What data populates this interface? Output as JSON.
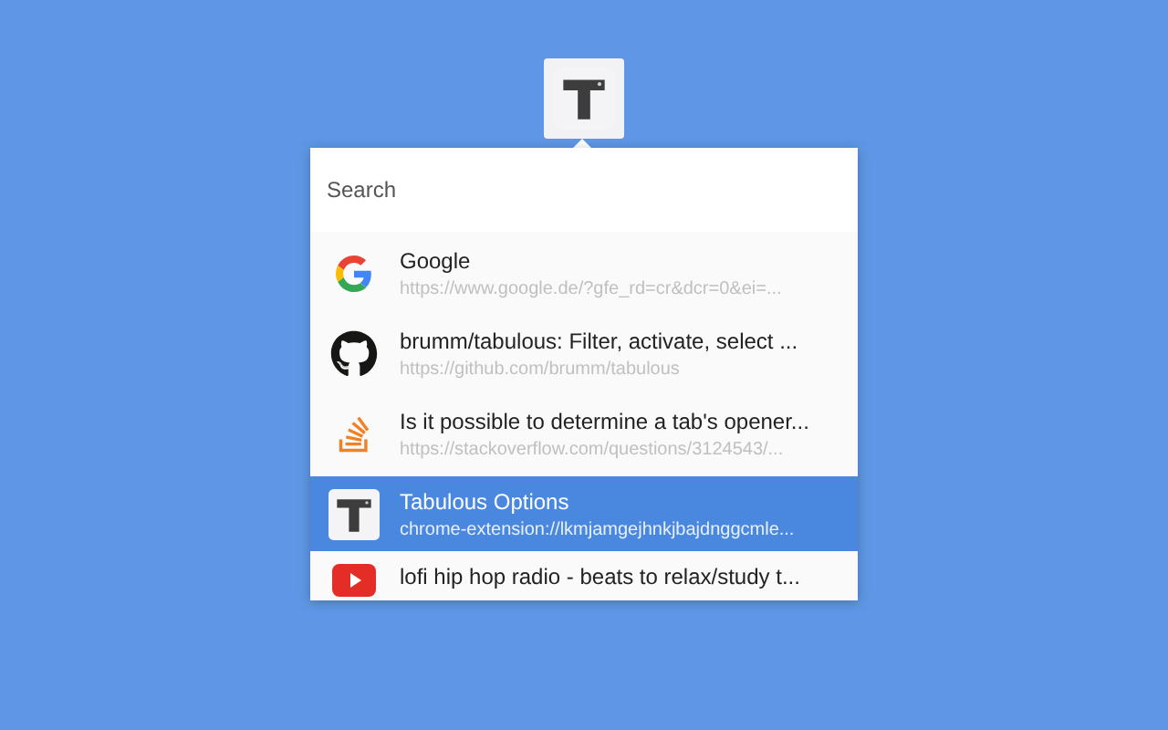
{
  "search": {
    "placeholder": "Search"
  },
  "tabs": [
    {
      "kind": "google",
      "title": "Google",
      "url": "https://www.google.de/?gfe_rd=cr&dcr=0&ei=...",
      "selected": false
    },
    {
      "kind": "github",
      "title": "brumm/tabulous: Filter, activate, select ...",
      "url": "https://github.com/brumm/tabulous",
      "selected": false
    },
    {
      "kind": "stackoverflow",
      "title": "Is it possible to determine a tab's opener...",
      "url": "https://stackoverflow.com/questions/3124543/...",
      "selected": false
    },
    {
      "kind": "tabulous",
      "title": "Tabulous Options",
      "url": "chrome-extension://lkmjamgejhnkjbajdnggcmle...",
      "selected": true
    },
    {
      "kind": "youtube",
      "title": "lofi hip hop radio - beats to relax/study t...",
      "selected": false
    }
  ]
}
